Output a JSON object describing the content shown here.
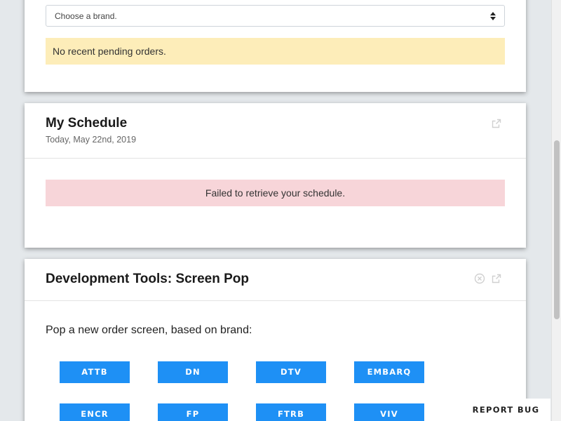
{
  "orders_card": {
    "brand_select": {
      "selected": "Choose a brand."
    },
    "alert": "No recent pending orders."
  },
  "schedule_card": {
    "title": "My Schedule",
    "subtitle": "Today, May 22nd, 2019",
    "alert": "Failed to retrieve your schedule.",
    "icons": [
      "external-link-icon"
    ]
  },
  "devtools_card": {
    "title": "Development Tools: Screen Pop",
    "description": "Pop a new order screen, based on brand:",
    "icons": [
      "close-circle-icon",
      "external-link-icon"
    ],
    "brands": [
      "ATTB",
      "DN",
      "DTV",
      "EMBARQ",
      "ENCR",
      "FP",
      "FTRB",
      "VIV"
    ]
  },
  "report_bug_label": "REPORT BUG",
  "colors": {
    "page_background": "#e4e8eb",
    "brand_button": "#1e90f5",
    "warning_alert": "#fdedb9",
    "danger_alert": "#f7d5d9"
  }
}
